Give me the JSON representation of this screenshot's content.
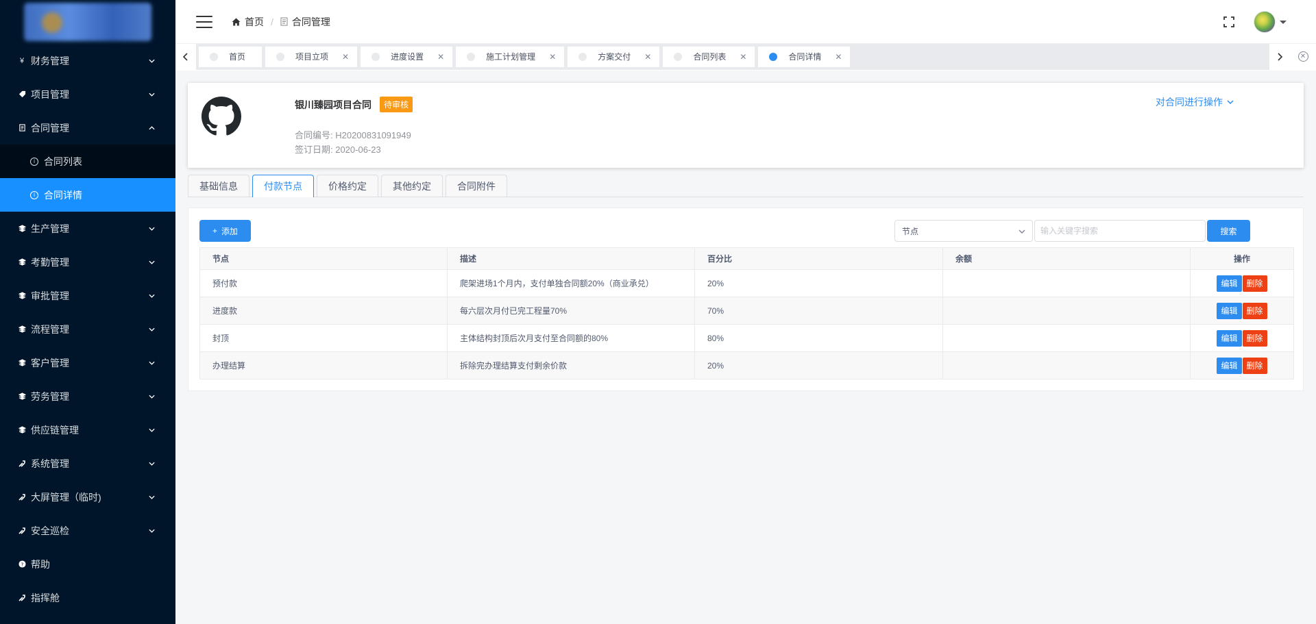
{
  "sidebar": {
    "items": [
      {
        "label": "财务管理",
        "icon": "yen-icon"
      },
      {
        "label": "项目管理",
        "icon": "tag-icon"
      },
      {
        "label": "合同管理",
        "icon": "document-icon",
        "expanded": true,
        "children": [
          {
            "label": "合同列表"
          },
          {
            "label": "合同详情",
            "active": true
          }
        ]
      },
      {
        "label": "生产管理",
        "icon": "layers-icon"
      },
      {
        "label": "考勤管理",
        "icon": "layers-icon"
      },
      {
        "label": "审批管理",
        "icon": "layers-icon"
      },
      {
        "label": "流程管理",
        "icon": "layers-icon"
      },
      {
        "label": "客户管理",
        "icon": "layers-icon"
      },
      {
        "label": "劳务管理",
        "icon": "layers-icon"
      },
      {
        "label": "供应链管理",
        "icon": "layers-icon"
      },
      {
        "label": "系统管理",
        "icon": "tools-icon"
      },
      {
        "label": "大屏管理（临时)",
        "icon": "tools-icon"
      },
      {
        "label": "安全巡检",
        "icon": "tools-icon"
      },
      {
        "label": "帮助",
        "icon": "help-icon"
      },
      {
        "label": "指挥舱",
        "icon": "tools-icon"
      }
    ]
  },
  "header": {
    "breadcrumb": {
      "home": "首页",
      "current": "合同管理"
    }
  },
  "tabs": [
    {
      "label": "首页",
      "closable": false,
      "active": false
    },
    {
      "label": "项目立项",
      "closable": true,
      "active": false
    },
    {
      "label": "进度设置",
      "closable": true,
      "active": false
    },
    {
      "label": "施工计划管理",
      "closable": true,
      "active": false
    },
    {
      "label": "方案交付",
      "closable": true,
      "active": false
    },
    {
      "label": "合同列表",
      "closable": true,
      "active": false
    },
    {
      "label": "合同详情",
      "closable": true,
      "active": true
    }
  ],
  "contract": {
    "title": "银川臻园项目合同",
    "status": "待审核",
    "number_label": "合同编号: H20200831091949",
    "date_label": "签订日期: 2020-06-23",
    "action": "对合同进行操作"
  },
  "page_tabs": [
    {
      "label": "基础信息",
      "active": false
    },
    {
      "label": "付款节点",
      "active": true
    },
    {
      "label": "价格约定",
      "active": false
    },
    {
      "label": "其他约定",
      "active": false
    },
    {
      "label": "合同附件",
      "active": false
    }
  ],
  "toolbar": {
    "add_label": "添加",
    "select_value": "节点",
    "search_placeholder": "输入关键字搜索",
    "search_label": "搜索"
  },
  "table": {
    "columns": [
      "节点",
      "描述",
      "百分比",
      "余额",
      "操作"
    ],
    "rows": [
      [
        "预付款",
        "爬架进场1个月内，支付单独合同额20%（商业承兑）",
        "20%",
        ""
      ],
      [
        "进度款",
        "每六层次月付已完工程量70%",
        "70%",
        ""
      ],
      [
        "封顶",
        "主体结构封顶后次月支付至合同额的80%",
        "80%",
        ""
      ],
      [
        "办理结算",
        "拆除完办理结算支付剩余价款",
        "20%",
        ""
      ]
    ],
    "edit_label": "编辑",
    "delete_label": "删除"
  },
  "colors": {
    "sidebar_bg": "#001529",
    "sidebar_active": "#1890ff",
    "primary": "#2d8cf0",
    "danger": "#ed4014",
    "warning": "#fa9a14"
  }
}
